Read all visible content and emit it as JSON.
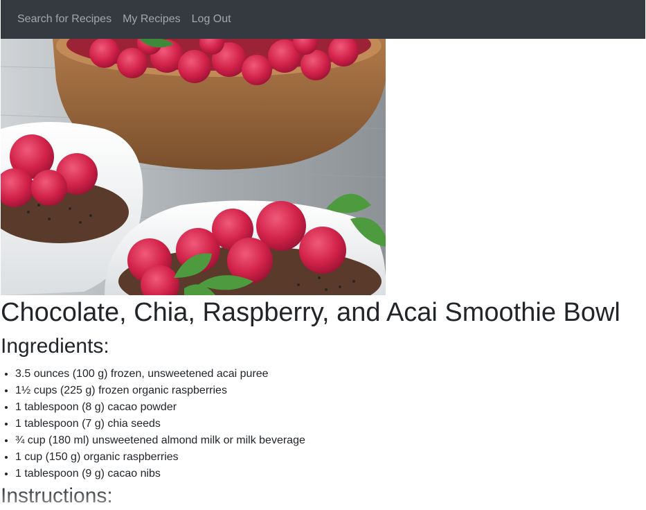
{
  "nav": {
    "links": [
      "Search for Recipes",
      "My Recipes",
      "Log Out"
    ],
    "bg_color": "#343a40"
  },
  "recipe": {
    "image": "smoothie-bowl-photo",
    "title": "Chocolate, Chia, Raspberry, and Acai Smoothie Bowl",
    "ingredients_heading": "Ingredients:",
    "ingredients": [
      "3.5 ounces (100 g) frozen, unsweetened acai puree",
      "1½ cups (225 g) frozen organic raspberries",
      "1 tablespoon (8 g) cacao powder",
      "1 tablespoon (7 g) chia seeds",
      "¾ cup (180 ml) unsweetened almond milk or milk beverage",
      "1 cup (150 g) organic raspberries",
      "1 tablespoon (9 g) cacao nibs"
    ],
    "instructions_heading": "Instructions:"
  }
}
